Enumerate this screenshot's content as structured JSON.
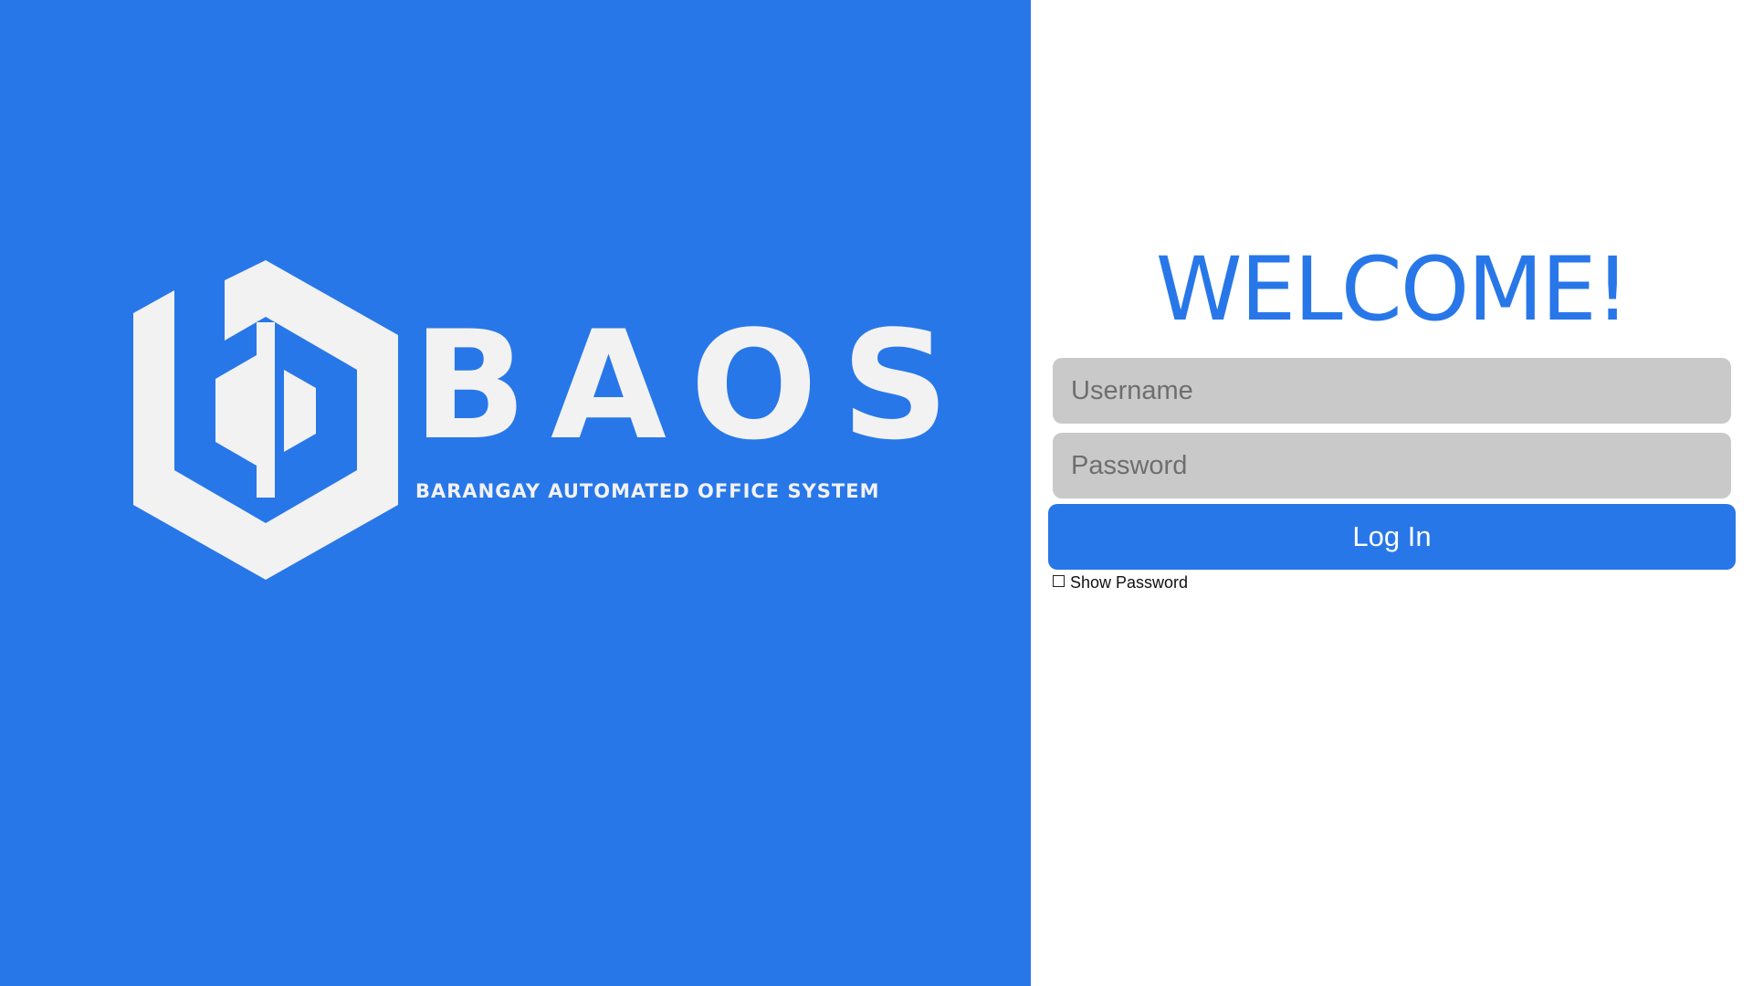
{
  "brand": {
    "name": "BAOS",
    "tagline": "BARANGAY AUTOMATED OFFICE  SYSTEM",
    "logo_icon": "hexagon-b-logo-icon",
    "panel_color": "#2877e9",
    "logo_color": "#f2f2f2"
  },
  "login": {
    "heading": "WELCOME!",
    "username_placeholder": "Username",
    "password_placeholder": "Password",
    "button_label": "Log In",
    "show_password_label": "Show Password",
    "show_password_checked": false,
    "accent_color": "#2877e9",
    "field_color": "#c9c9c9"
  }
}
